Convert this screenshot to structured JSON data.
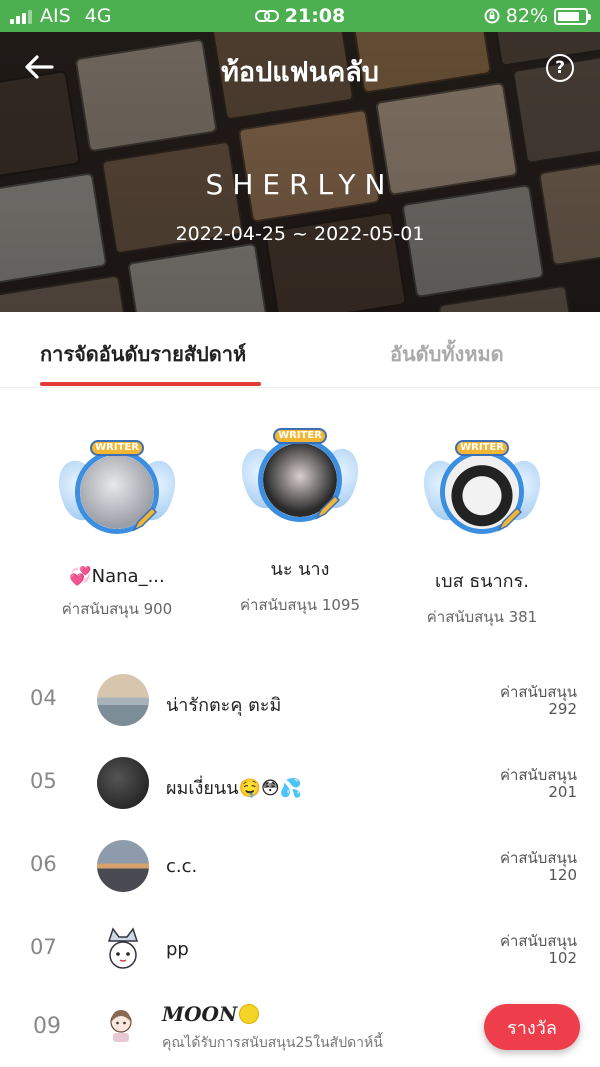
{
  "status_bar": {
    "carrier": "AIS",
    "network": "4G",
    "time": "21:08",
    "battery": "82%",
    "battery_level": 0.82
  },
  "header": {
    "title": "ท้อปแฟนคลับ",
    "club_name": "SHERLYN",
    "date_range": "2022-04-25 ~ 2022-05-01"
  },
  "tabs": [
    {
      "label": "การจัดอันดับรายสัปดาห์",
      "active": true
    },
    {
      "label": "อันดับทั้งหมด",
      "active": false
    }
  ],
  "badge_label": "WRITER",
  "top3": [
    {
      "name": "💞Nana_...",
      "support": "ค่าสนับสนุน 900",
      "photo_color": "#b9bcc2"
    },
    {
      "name": "นะ นาง",
      "support": "ค่าสนับสนุน 1095",
      "photo_color": "#3a3a3a"
    },
    {
      "name": "เบส ธนากร.",
      "support": "ค่าสนับสนุน 381",
      "photo_color": "#e6e6e6"
    }
  ],
  "ranking": [
    {
      "rank": "04",
      "name": "น่ารักตะคุ ตะมิ",
      "support_label": "ค่าสนับสนุน",
      "support_value": "292",
      "avatar_color": "#c9b9a3"
    },
    {
      "rank": "05",
      "name": "ผมเงี่ยนน🤤😳💦",
      "support_label": "ค่าสนับสนุน",
      "support_value": "201",
      "avatar_color": "#2a2a2a"
    },
    {
      "rank": "06",
      "name": "c.c.",
      "support_label": "ค่าสนับสนุน",
      "support_value": "120",
      "avatar_color": "#8a8f9a"
    },
    {
      "rank": "07",
      "name": "pp",
      "support_label": "ค่าสนับสนุน",
      "support_value": "102",
      "avatar_color": "#ffffff"
    }
  ],
  "me": {
    "rank": "09",
    "name": "MOON",
    "note": "คุณได้รับการสนับสนุน25ในสัปดาห์นี้",
    "reward_button": "รางวัล"
  },
  "colors": {
    "status_bar": "#4caf50",
    "accent": "#e53935",
    "reward_button": "#ef3e4b"
  }
}
